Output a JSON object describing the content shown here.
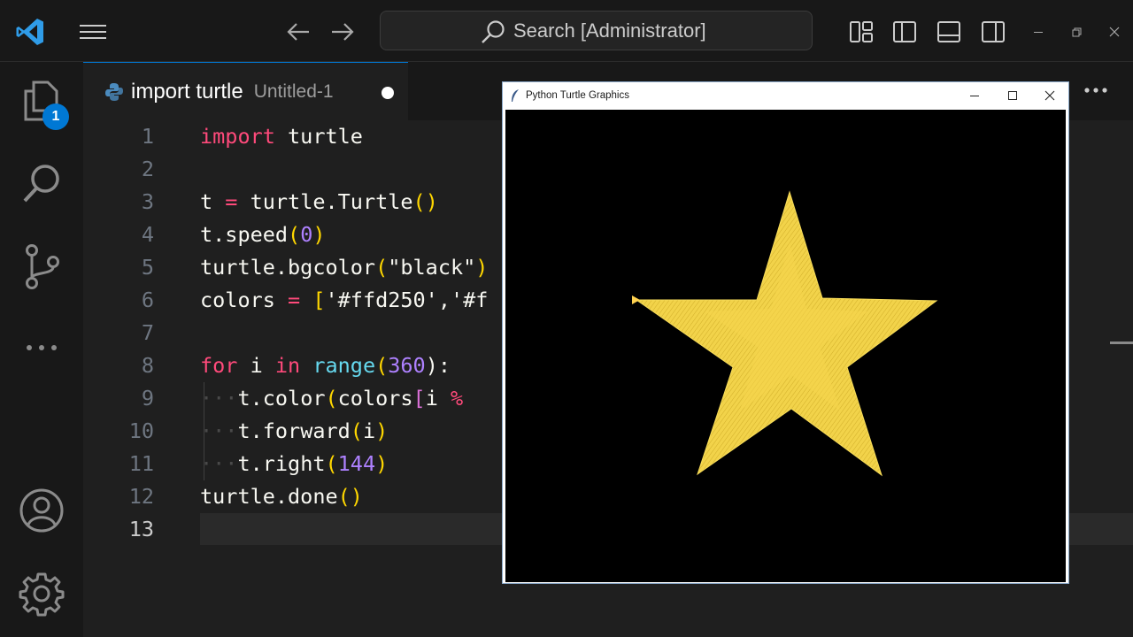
{
  "titlebar": {
    "search_text": "Search [Administrator]"
  },
  "activity_bar": {
    "explorer_badge": "1"
  },
  "tab": {
    "title": "import turtle",
    "subtitle": "Untitled-1"
  },
  "editor": {
    "line_numbers": [
      "1",
      "2",
      "3",
      "4",
      "5",
      "6",
      "7",
      "8",
      "9",
      "10",
      "11",
      "12",
      "13"
    ],
    "active_line": "13",
    "lines": {
      "l1": {
        "t1": "import",
        "t2": " turtle"
      },
      "l3": {
        "t1": "t",
        "t2": " = ",
        "t3": "turtle.Turtle",
        "t4": "()"
      },
      "l4": {
        "t1": "t.speed",
        "t2": "(",
        "t3": "0",
        "t4": ")"
      },
      "l5": {
        "t1": "turtle.bgcolor",
        "t2": "(",
        "t3": "\"black\"",
        "t4": ")"
      },
      "l6": {
        "t1": "colors",
        "t2": " = ",
        "t3": "[",
        "t4": "'#ffd250','#f"
      },
      "l8": {
        "t1": "for",
        "t2": " i ",
        "t3": "in",
        "t4": " ",
        "t5": "range",
        "t6": "(",
        "t7": "360",
        "t8": "):"
      },
      "l9": {
        "t0": "···",
        "t1": "t.color",
        "t2": "(",
        "t3": "colors",
        "t4": "[",
        "t5": "i ",
        "t6": "%"
      },
      "l10": {
        "t0": "···",
        "t1": "t.forward",
        "t2": "(",
        "t3": "i",
        "t4": ")"
      },
      "l11": {
        "t0": "···",
        "t1": "t.right",
        "t2": "(",
        "t3": "144",
        "t4": ")"
      },
      "l12": {
        "t1": "turtle.done",
        "t2": "()"
      }
    }
  },
  "turtle_window": {
    "title": "Python Turtle Graphics",
    "background": "#000000",
    "star_color": "#ffd250"
  },
  "colors": {
    "accent": "#0078d4",
    "keyword": "#ff4a7b",
    "number": "#ae81ff",
    "bracket": "#ffd700"
  }
}
